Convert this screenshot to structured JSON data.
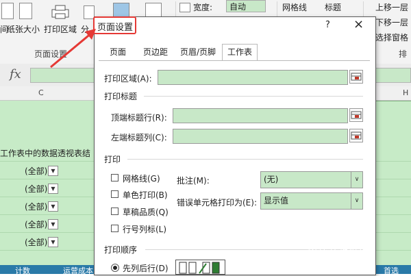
{
  "ribbon": {
    "buttons": [
      "间",
      "纸张大小",
      "打印区域",
      "分"
    ],
    "group_label": "页面设置",
    "width_label": "宽度:",
    "width_value": "自动",
    "gridlines_label": "网格线",
    "headings_label": "标题",
    "right_items": [
      "上移一层",
      "下移一层",
      "选择窗格"
    ],
    "right_group_label": "排"
  },
  "formula_bar": {
    "fx": "fx"
  },
  "sheet": {
    "col_c": "C",
    "col_h": "H",
    "text_row": "工作表中的数据透视表结",
    "filter_value": "(全部)",
    "status_items": [
      "计数",
      "运营成本",
      "首选"
    ]
  },
  "dialog": {
    "title": "页面设置",
    "help": "?",
    "close": "×",
    "tabs": [
      "页面",
      "页边距",
      "页眉/页脚",
      "工作表"
    ],
    "print_area_label": "打印区域(A):",
    "print_titles_section": "打印标题",
    "top_rows_label": "顶端标题行(R):",
    "left_cols_label": "左端标题列(C):",
    "print_section": "打印",
    "checkboxes": [
      "网格线(G)",
      "单色打印(B)",
      "草稿品质(Q)",
      "行号列标(L)"
    ],
    "comments_label": "批注(M):",
    "comments_value": "(无)",
    "errors_label": "错误单元格打印为(E):",
    "errors_value": "显示值",
    "order_section": "打印顺序",
    "order_option": "先列后行(D)"
  },
  "watermark": {
    "title": "百科全说",
    "subtitle": "助你轻松解决"
  },
  "colors": {
    "highlight": "#e53935",
    "cell_green": "#c7ebc7",
    "statusbar": "#2a7aa8"
  }
}
